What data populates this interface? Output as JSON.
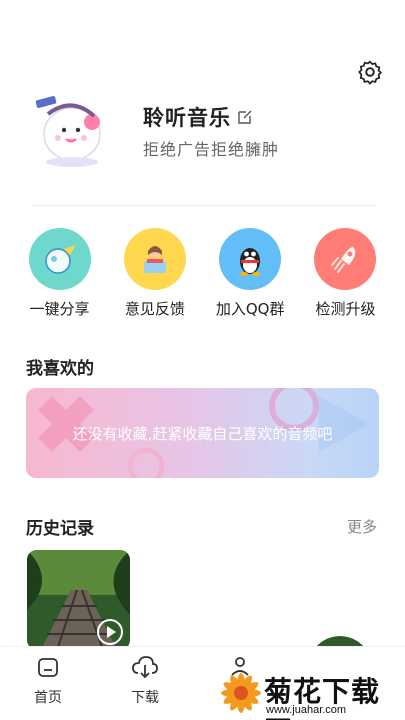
{
  "profile": {
    "app_name": "聆听音乐",
    "slogan": "拒绝广告拒绝臃肿"
  },
  "quick_actions": [
    {
      "label": "一键分享",
      "icon": "share-globe-icon",
      "color": "#5fd1c6"
    },
    {
      "label": "意见反馈",
      "icon": "feedback-person-icon",
      "color": "#ffd54a"
    },
    {
      "label": "加入QQ群",
      "icon": "qq-penguin-icon",
      "color": "#5eb8f5"
    },
    {
      "label": "检测升级",
      "icon": "rocket-icon",
      "color": "#ff7b73"
    }
  ],
  "favorites": {
    "title": "我喜欢的",
    "empty_text": "还没有收藏,赶紧收藏自己喜欢的音频吧"
  },
  "history": {
    "title": "历史记录",
    "more": "更多"
  },
  "tabs": [
    {
      "label": "首页",
      "icon": "home-icon"
    },
    {
      "label": "下载",
      "icon": "cloud-download-icon"
    },
    {
      "label": "",
      "icon": "user-icon"
    }
  ],
  "watermark": {
    "text": "菊花下载网",
    "url": "www.juahar.com"
  }
}
